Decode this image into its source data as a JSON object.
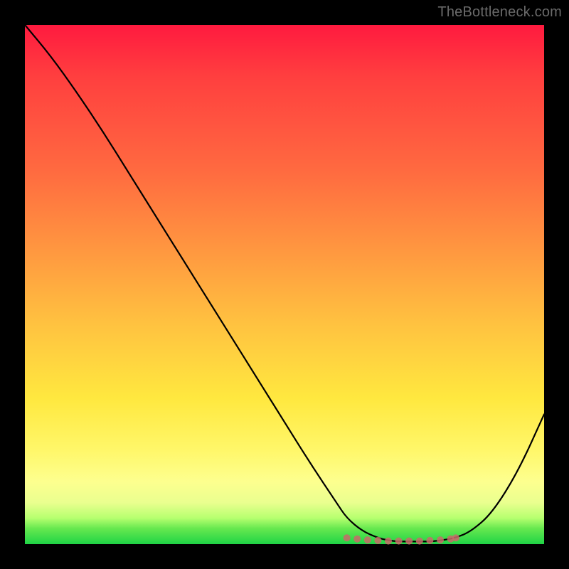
{
  "watermark": "TheBottleneck.com",
  "chart_data": {
    "type": "line",
    "title": "",
    "xlabel": "",
    "ylabel": "",
    "xlim": [
      0,
      100
    ],
    "ylim": [
      0,
      100
    ],
    "grid": false,
    "legend": false,
    "series": [
      {
        "name": "bottleneck-curve",
        "color": "#000000",
        "x": [
          0,
          5,
          10,
          15,
          20,
          25,
          30,
          35,
          40,
          45,
          50,
          55,
          60,
          62,
          65,
          68,
          70,
          72,
          75,
          78,
          80,
          83,
          86,
          90,
          95,
          100
        ],
        "y": [
          100,
          94,
          87,
          79.5,
          71.5,
          63.5,
          55.5,
          47.5,
          39.5,
          31.5,
          23.5,
          15.5,
          8,
          5,
          2.5,
          1.2,
          0.7,
          0.5,
          0.5,
          0.5,
          0.7,
          1.2,
          2.5,
          6,
          14,
          25
        ]
      },
      {
        "name": "bottom-markers",
        "color": "#c96a6a",
        "type": "scatter",
        "x": [
          62,
          64,
          66,
          68,
          70,
          72,
          74,
          76,
          78,
          80,
          82,
          83
        ],
        "y": [
          1.2,
          1.0,
          0.8,
          0.7,
          0.6,
          0.6,
          0.6,
          0.6,
          0.7,
          0.8,
          1.0,
          1.2
        ]
      }
    ]
  },
  "colors": {
    "frame": "#000000",
    "curve": "#000000",
    "markers": "#c96a6a"
  }
}
